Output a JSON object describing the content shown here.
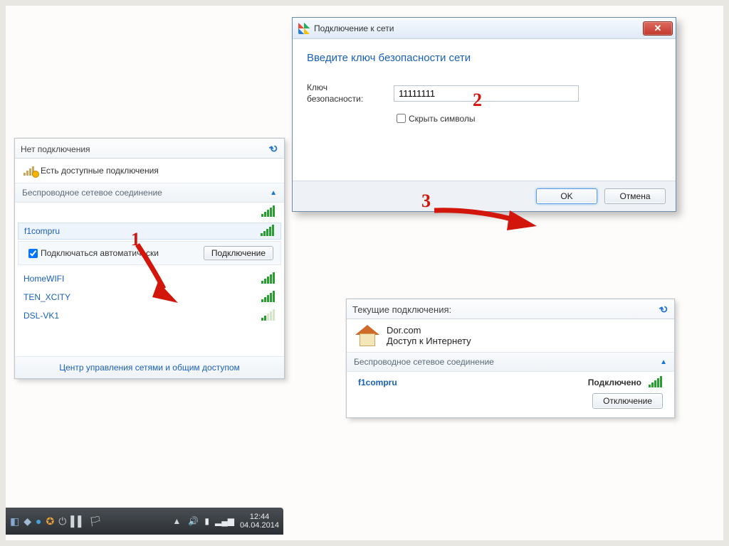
{
  "left_flyout": {
    "header": "Нет подключения",
    "avail": "Есть доступные подключения",
    "section": "Беспроводное сетевое соединение",
    "networks": [
      {
        "name": "",
        "sig": "full",
        "faded": true
      },
      {
        "name": "f1compru",
        "sig": "full",
        "selected": true
      },
      {
        "name": "HomeWIFI",
        "sig": "full"
      },
      {
        "name": "TEN_XCITY",
        "sig": "full"
      },
      {
        "name": "DSL-VK1",
        "sig": "weak"
      }
    ],
    "auto_label": "Подключаться автоматически",
    "connect_btn": "Подключение",
    "footer_link": "Центр управления сетями и общим доступом"
  },
  "dialog": {
    "title": "Подключение к сети",
    "prompt": "Введите ключ безопасности сети",
    "field_label": "Ключ безопасности:",
    "field_value": "11111111",
    "hide_label": "Скрыть символы",
    "ok": "OK",
    "cancel": "Отмена"
  },
  "right_flyout": {
    "header": "Текущие подключения:",
    "network_name": "Dor.com",
    "access_label": "Доступ к Интернету",
    "section": "Беспроводное сетевое соединение",
    "ssid": "f1compru",
    "status": "Подключено",
    "disconnect": "Отключение"
  },
  "steps": {
    "one": "1",
    "two": "2",
    "three": "3"
  },
  "taskbar": {
    "time": "12:44",
    "date": "04.04.2014"
  }
}
